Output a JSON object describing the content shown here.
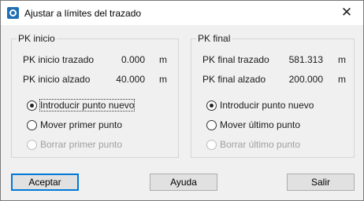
{
  "window": {
    "title": "Ajustar a límites del trazado",
    "close_glyph": "✕"
  },
  "pk_inicio": {
    "group_label": "PK inicio",
    "rows": [
      {
        "label": "PK inicio trazado",
        "value": "0.000",
        "unit": "m"
      },
      {
        "label": "PK inicio alzado",
        "value": "40.000",
        "unit": "m"
      }
    ],
    "options": [
      {
        "label": "Introducir punto nuevo",
        "checked": true,
        "enabled": true
      },
      {
        "label": "Mover primer punto",
        "checked": false,
        "enabled": true
      },
      {
        "label": "Borrar primer punto",
        "checked": false,
        "enabled": false
      }
    ]
  },
  "pk_final": {
    "group_label": "PK final",
    "rows": [
      {
        "label": "PK final trazado",
        "value": "581.313",
        "unit": "m"
      },
      {
        "label": "PK final alzado",
        "value": "200.000",
        "unit": "m"
      }
    ],
    "options": [
      {
        "label": "Introducir punto nuevo",
        "checked": true,
        "enabled": true
      },
      {
        "label": "Mover último punto",
        "checked": false,
        "enabled": true
      },
      {
        "label": "Borrar último punto",
        "checked": false,
        "enabled": false
      }
    ]
  },
  "buttons": {
    "accept": "Aceptar",
    "help": "Ayuda",
    "exit": "Salir"
  }
}
